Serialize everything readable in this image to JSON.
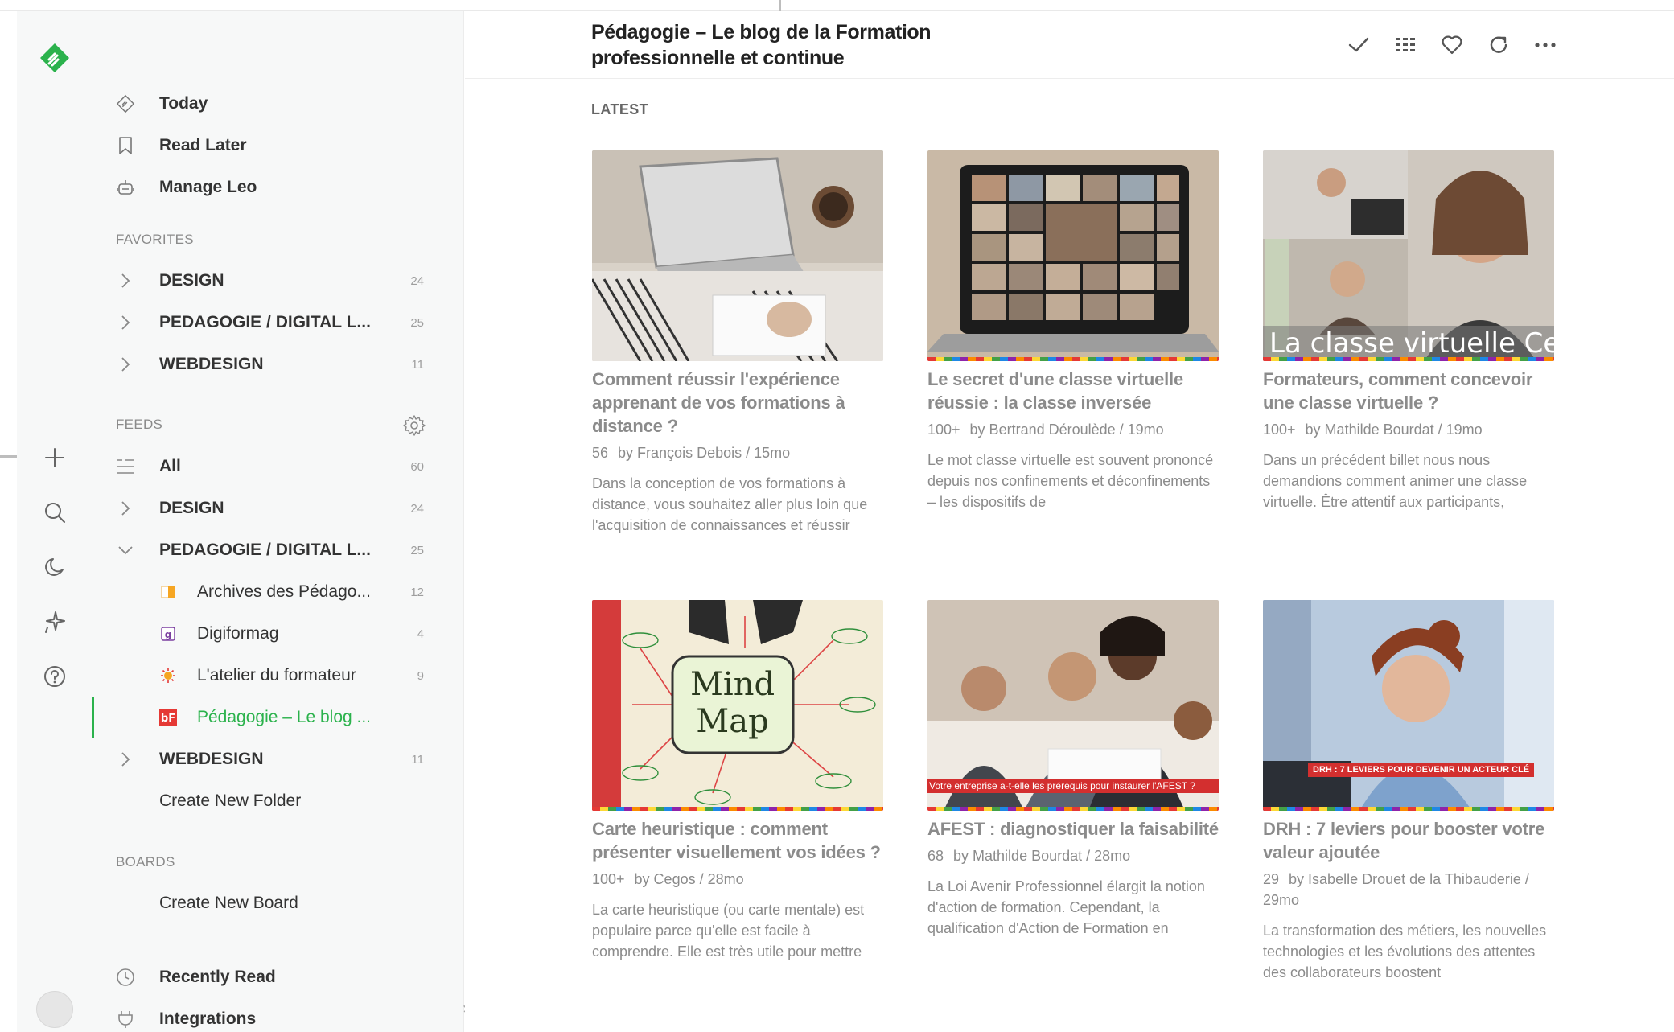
{
  "nav": {
    "top_items": [
      {
        "label": "Today",
        "icon": "today-icon"
      },
      {
        "label": "Read Later",
        "icon": "bookmark-icon"
      },
      {
        "label": "Manage Leo",
        "icon": "leo-robot-icon"
      }
    ],
    "favorites_header": "FAVORITES",
    "favorites": [
      {
        "label": "DESIGN",
        "count": "24"
      },
      {
        "label": "PEDAGOGIE / DIGITAL L...",
        "count": "25"
      },
      {
        "label": "WEBDESIGN",
        "count": "11"
      }
    ],
    "feeds_header": "FEEDS",
    "feeds_all": {
      "label": "All",
      "count": "60"
    },
    "feeds": [
      {
        "label": "DESIGN",
        "count": "24"
      },
      {
        "label": "PEDAGOGIE / DIGITAL L...",
        "count": "25"
      }
    ],
    "sources": [
      {
        "label": "Archives des Pédago...",
        "count": "12"
      },
      {
        "label": "Digiformag",
        "count": "4"
      },
      {
        "label": "L'atelier du formateur",
        "count": "9"
      },
      {
        "label": "Pédagogie – Le blog ...",
        "count": ""
      }
    ],
    "webdesign": {
      "label": "WEBDESIGN",
      "count": "11"
    },
    "create_folder": "Create New Folder",
    "boards_header": "BOARDS",
    "create_board": "Create New Board",
    "recently_read": "Recently Read",
    "integrations": "Integrations"
  },
  "main": {
    "title": "Pédagogie – Le blog de la Formation professionnelle et continue",
    "section": "LATEST",
    "overlay_text_3": "La classe virtuelle Cegos",
    "banner_text_5": "Votre entreprise a-t-elle les prérequis pour instaurer l'AFEST ?",
    "badge_text_6": "DRH : 7 LEVIERS POUR DEVENIR UN ACTEUR CLÉ",
    "mindmap_title": "Mind Map",
    "articles": [
      {
        "title": "Comment réussir l'expérience apprenant de vos formations à distance ?",
        "engagement": "56",
        "byline": "by François Debois / 15mo",
        "snippet": "Dans la conception de vos formations à distance, vous souhaitez aller plus loin que l'acquisition de connaissances et réussir"
      },
      {
        "title": "Le secret d'une classe virtuelle réussie : la classe inversée",
        "engagement": "100+",
        "byline": "by Bertrand Déroulède / 19mo",
        "snippet": "Le mot classe virtuelle est souvent prononcé depuis nos confinements et déconfinements – les dispositifs de"
      },
      {
        "title": "Formateurs, comment concevoir une classe virtuelle ?",
        "engagement": "100+",
        "byline": "by Mathilde Bourdat / 19mo",
        "snippet": "Dans un précédent billet nous nous demandions comment animer une classe virtuelle. Être attentif aux participants,"
      },
      {
        "title": "Carte heuristique : comment présenter visuellement vos idées ?",
        "engagement": "100+",
        "byline": "by Cegos / 28mo",
        "snippet": "La carte heuristique (ou carte mentale) est populaire parce qu'elle est facile à comprendre. Elle est très utile pour mettre"
      },
      {
        "title": "AFEST : diagnostiquer la faisabilité",
        "engagement": "68",
        "byline": "by Mathilde Bourdat / 28mo",
        "snippet": "La Loi Avenir Professionnel élargit la notion d'action de formation. Cependant, la qualification d'Action de Formation en"
      },
      {
        "title": "DRH : 7 leviers pour booster votre valeur ajoutée",
        "engagement": "29",
        "byline": "by Isabelle Drouet de la Thibauderie / 29mo",
        "snippet": "La transformation des métiers, les nouvelles technologies et les évolutions des attentes des collaborateurs boostent"
      }
    ]
  },
  "colors": {
    "accent": "#2bb24c",
    "rail_bg": "#f7f8f8",
    "muted": "#8b8b8b"
  }
}
